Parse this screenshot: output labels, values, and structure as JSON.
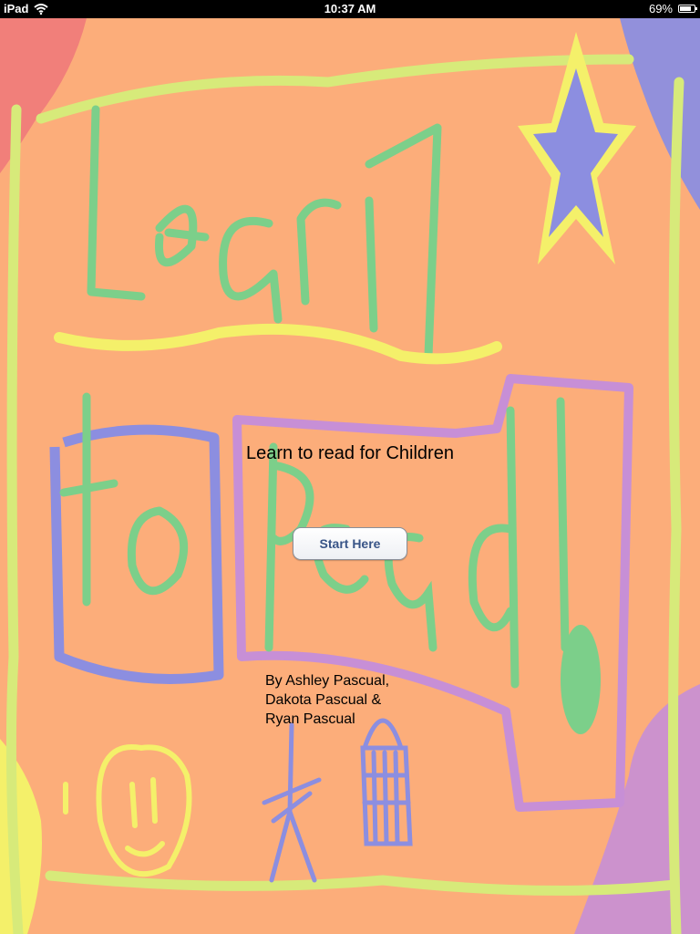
{
  "status_bar": {
    "device": "iPad",
    "time": "10:37 AM",
    "battery": "69%"
  },
  "content": {
    "subtitle": "Learn to read for Children",
    "start_button": "Start Here",
    "credits": [
      "By Ashley Pascual,",
      "Dakota Pascual &",
      "Ryan Pascual"
    ]
  },
  "colors": {
    "background": "#fcad7a",
    "green": "#7ccf8a",
    "yellow": "#f4f06a",
    "blue": "#8c8ee0",
    "purple": "#c78fd6",
    "red": "#f07a7a"
  }
}
